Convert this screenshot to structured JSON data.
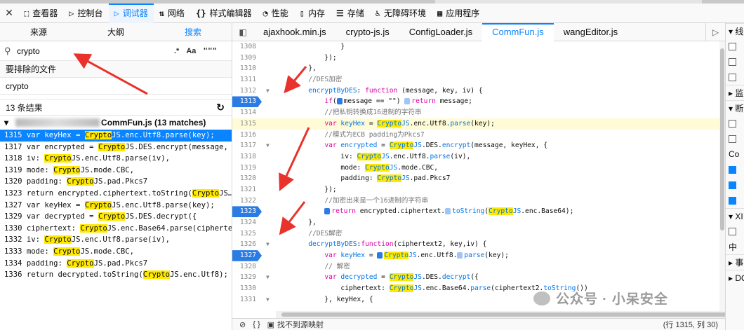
{
  "toolbar": {
    "close_icon": "close-icon",
    "tabs": [
      {
        "label": "查看器",
        "icon": "⬚"
      },
      {
        "label": "控制台",
        "icon": "▷"
      },
      {
        "label": "调试器",
        "icon": "▷"
      },
      {
        "label": "网络",
        "icon": "⇅"
      },
      {
        "label": "样式编辑器",
        "icon": "{}"
      },
      {
        "label": "性能",
        "icon": "◔"
      },
      {
        "label": "内存",
        "icon": "▯"
      },
      {
        "label": "存储",
        "icon": "☰"
      },
      {
        "label": "无障碍环境",
        "icon": "♿"
      },
      {
        "label": "应用程序",
        "icon": "▦"
      }
    ]
  },
  "left": {
    "tabs": [
      "来源",
      "大纲",
      "搜索"
    ],
    "search": {
      "value": "crypto",
      "opt_regex": ".*",
      "opt_case": "Aa",
      "opt_word": "\"\"\""
    },
    "exclude_label": "要排除的文件",
    "exclude_value": "crypto",
    "result_count": "13 条结果",
    "refresh_icon": "↻",
    "file_label": "CommFun.js (13 matches)",
    "results": [
      {
        "pre": "1315 var keyHex = ",
        "hl": "Crypto",
        "post": "JS.enc.Utf8.parse(key);"
      },
      {
        "pre": "1317 var encrypted = ",
        "hl": "Crypto",
        "post": "JS.DES.encrypt(message, …"
      },
      {
        "pre": "1318 iv: ",
        "hl": "Crypto",
        "post": "JS.enc.Utf8.parse(iv),"
      },
      {
        "pre": "1319 mode: ",
        "hl": "Crypto",
        "post": "JS.mode.CBC,"
      },
      {
        "pre": "1320 padding: ",
        "hl": "Crypto",
        "post": "JS.pad.Pkcs7"
      },
      {
        "pre": "1323 return encrypted.ciphertext.toString(",
        "hl": "Crypto",
        "post": "JS…"
      },
      {
        "pre": "1327 var keyHex = ",
        "hl": "Crypto",
        "post": "JS.enc.Utf8.parse(key);"
      },
      {
        "pre": "1329 var decrypted = ",
        "hl": "Crypto",
        "post": "JS.DES.decrypt({"
      },
      {
        "pre": "1330 ciphertext: ",
        "hl": "Crypto",
        "post": "JS.enc.Base64.parse(cipherte…"
      },
      {
        "pre": "1332 iv: ",
        "hl": "Crypto",
        "post": "JS.enc.Utf8.parse(iv),"
      },
      {
        "pre": "1333 mode: ",
        "hl": "Crypto",
        "post": "JS.mode.CBC,"
      },
      {
        "pre": "1334 padding: ",
        "hl": "Crypto",
        "post": "JS.pad.Pkcs7"
      },
      {
        "pre": "1336 return decrypted.toString(",
        "hl": "Crypto",
        "post": "JS.enc.Utf8);"
      }
    ]
  },
  "editor": {
    "tabs": [
      "ajaxhook.min.js",
      "crypto-js.js",
      "ConfigLoader.js",
      "CommFun.js",
      "wangEditor.js"
    ],
    "active_tab": "CommFun.js",
    "lines": [
      {
        "n": "1308",
        "html": "                }"
      },
      {
        "n": "1309",
        "html": "            });"
      },
      {
        "n": "1310",
        "html": "        },"
      },
      {
        "n": "1311",
        "html": "        <span class='cm'>//DES加密</span>"
      },
      {
        "n": "1312",
        "fold": true,
        "html": "        <span class='fn'>encryptByDES</span>: <span class='kw'>function</span> (message, key, iv) {"
      },
      {
        "n": "1313",
        "bp": true,
        "html": "            <span class='kw'>if</span>(<span class='bpm'></span>message == \"\") <span class='bpm l'></span><span class='kw'>return</span> message;"
      },
      {
        "n": "1314",
        "html": "            <span class='cm'>//把私钥转换成16进制的字符串</span>"
      },
      {
        "n": "1315",
        "cur": true,
        "html": "            <span class='kw'>var</span> <span class='prop'>keyHex</span> = <span class='cls'>Crypto</span><span class='prop'>JS</span>.enc.Utf8.<span class='prop'>parse</span>(key);"
      },
      {
        "n": "1316",
        "html": "            <span class='cm'>//模式为ECB padding为Pkcs7</span>"
      },
      {
        "n": "1317",
        "fold": true,
        "html": "            <span class='kw'>var</span> <span class='prop'>encrypted</span> = <span class='cls'>Crypto</span><span class='prop'>JS</span>.DES.<span class='prop'>encrypt</span>(message, keyHex, {"
      },
      {
        "n": "1318",
        "html": "                iv: <span class='cls'>Crypto</span><span class='prop'>JS</span>.enc.Utf8.<span class='prop'>parse</span>(iv),"
      },
      {
        "n": "1319",
        "html": "                mode: <span class='cls'>Crypto</span><span class='prop'>JS</span>.mode.CBC,"
      },
      {
        "n": "1320",
        "html": "                padding: <span class='cls'>Crypto</span><span class='prop'>JS</span>.pad.Pkcs7"
      },
      {
        "n": "1321",
        "html": "            });"
      },
      {
        "n": "1322",
        "html": "            <span class='cm'>//加密出来是一个16进制的字符串</span>"
      },
      {
        "n": "1323",
        "bp": true,
        "html": "            <span class='bpm'></span><span class='kw'>return</span> encrypted.ciphertext.<span class='bpm l'></span><span class='prop'>toString</span>(<span class='cls'>Crypto</span><span class='prop'>JS</span>.enc.Base64);"
      },
      {
        "n": "1324",
        "html": "        },"
      },
      {
        "n": "1325",
        "html": "        <span class='cm'>//DES解密</span>"
      },
      {
        "n": "1326",
        "fold": true,
        "html": "        <span class='fn'>decryptByDES</span>:<span class='kw'>function</span>(ciphertext2, key,iv) {"
      },
      {
        "n": "1327",
        "bp": true,
        "html": "            <span class='kw'>var</span> <span class='prop'>keyHex</span> = <span class='bpm'></span><span class='cls'>Crypto</span><span class='prop'>JS</span>.enc.Utf8.<span class='bpm l'></span><span class='prop'>parse</span>(key);"
      },
      {
        "n": "1328",
        "html": "            <span class='cm'>// 解密</span>"
      },
      {
        "n": "1329",
        "fold": true,
        "html": "            <span class='kw'>var</span> <span class='prop'>decrypted</span> = <span class='cls'>Crypto</span><span class='prop'>JS</span>.DES.<span class='prop'>decrypt</span>({"
      },
      {
        "n": "1330",
        "html": "                ciphertext: <span class='cls'>Crypto</span><span class='prop'>JS</span>.enc.Base64.<span class='prop'>parse</span>(ciphertext2.<span class='prop'>toString</span>())"
      },
      {
        "n": "1331",
        "fold": true,
        "html": "            }, keyHex, {"
      }
    ],
    "status_source_map": "找不到源映射",
    "status_pos": "(行 1315, 列 30)"
  },
  "right": {
    "items": [
      {
        "kind": "head",
        "text": "▾ 线"
      },
      {
        "kind": "chk",
        "on": false
      },
      {
        "kind": "chk",
        "on": false
      },
      {
        "kind": "chk",
        "on": false
      },
      {
        "kind": "head",
        "text": "▸ 监"
      },
      {
        "kind": "head",
        "text": "▾ 断"
      },
      {
        "kind": "chk",
        "on": false
      },
      {
        "kind": "chk",
        "on": false
      },
      {
        "kind": "text",
        "text": "Co"
      },
      {
        "kind": "chk",
        "on": true
      },
      {
        "kind": "chk",
        "on": true
      },
      {
        "kind": "chk",
        "on": true
      },
      {
        "kind": "head",
        "text": "▾ XI"
      },
      {
        "kind": "chk",
        "on": false
      },
      {
        "kind": "text",
        "text": "中"
      },
      {
        "kind": "head",
        "text": "▸ 事"
      },
      {
        "kind": "head",
        "text": "▸ DO"
      }
    ]
  },
  "watermark": "公众号 · 小呆安全"
}
